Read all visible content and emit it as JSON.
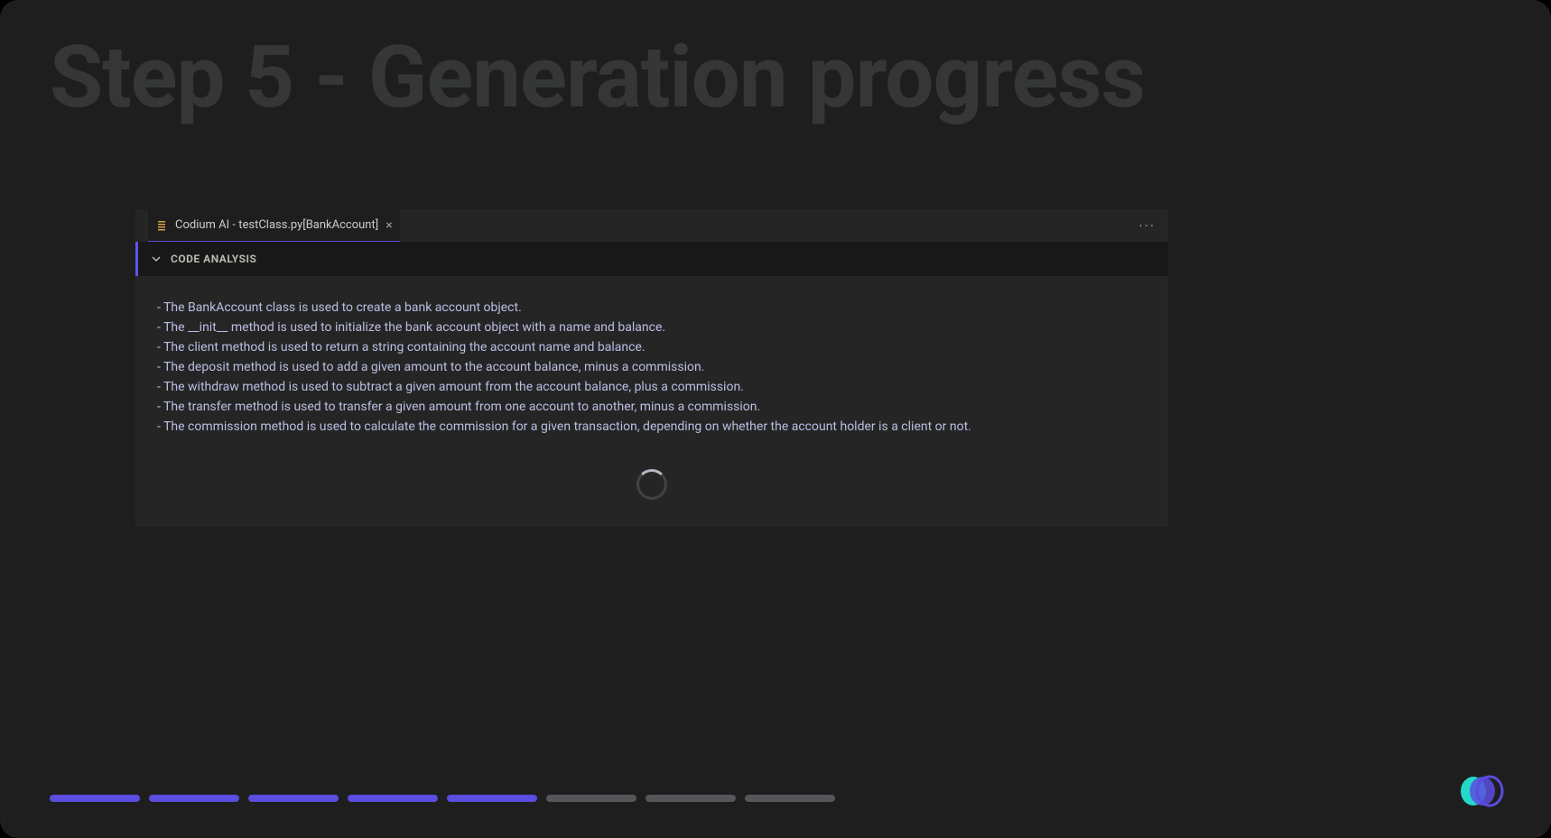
{
  "page_title": "Step 5 - Generation progress",
  "tab": {
    "label": "Codium AI - testClass.py[BankAccount]"
  },
  "section": {
    "title": "CODE ANALYSIS"
  },
  "analysis_lines": [
    "- The BankAccount class is used to create a bank account object.",
    "- The __init__ method is used to initialize the bank account object with a name and balance.",
    "- The client method is used to return a string containing the account name and balance.",
    "- The deposit method is used to add a given amount to the account balance, minus a commission.",
    "- The withdraw method is used to subtract a given amount from the account balance, plus a commission.",
    "- The transfer method is used to transfer a given amount from one account to another, minus a commission.",
    "- The commission method is used to calculate the commission for a given transaction, depending on whether the account holder is a client or not."
  ],
  "progress": {
    "total_segments": 8,
    "completed_segments": 5
  }
}
